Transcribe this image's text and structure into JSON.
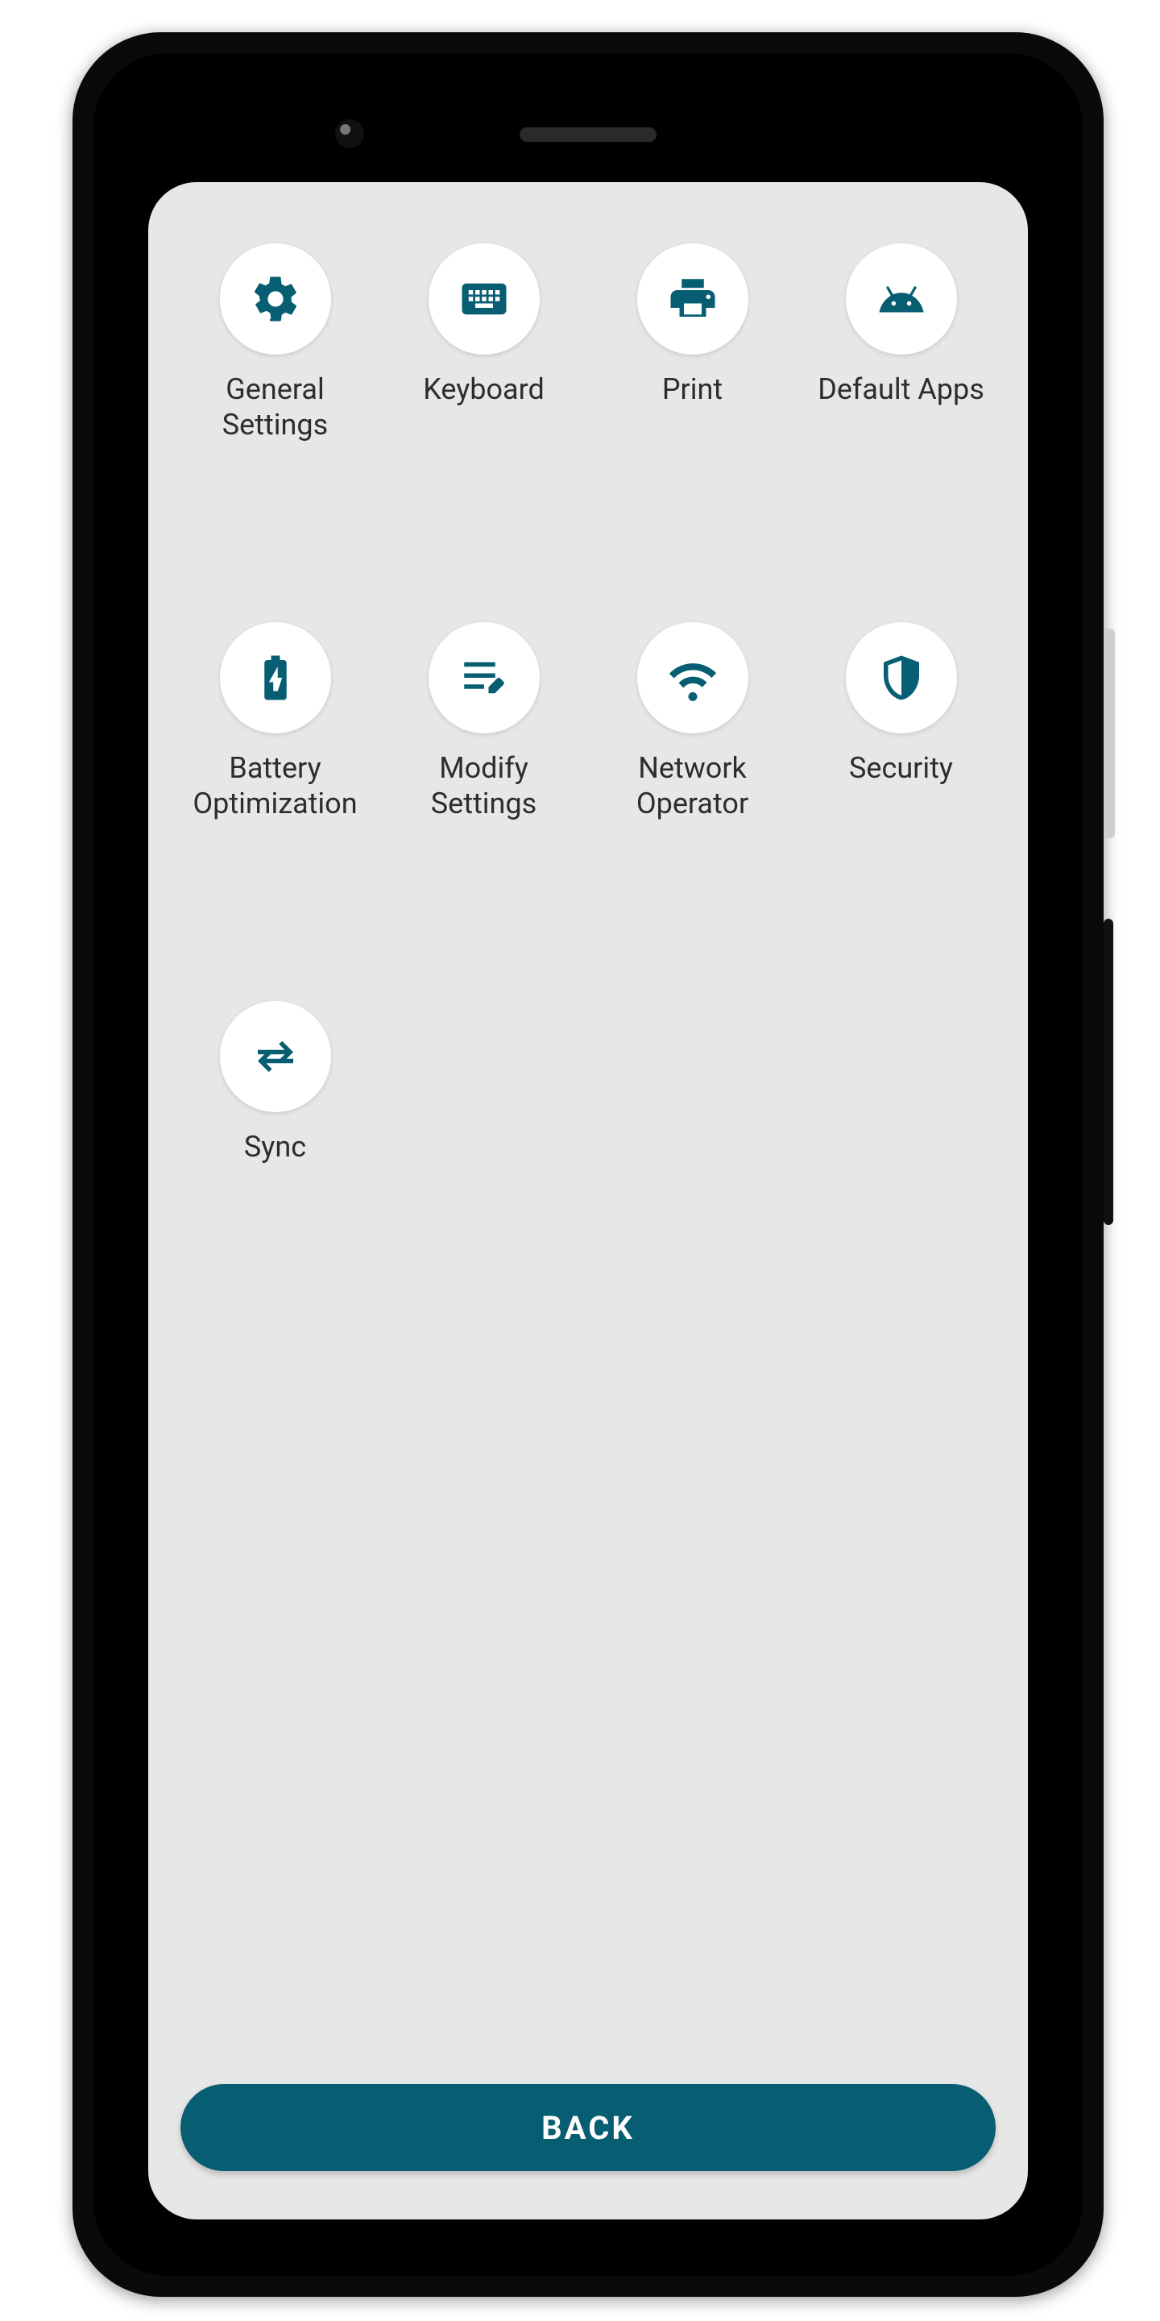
{
  "colors": {
    "accent": "#075e72",
    "screen_bg": "#e7e7e7",
    "tile_bg": "#ffffff",
    "text": "#2d2d2d"
  },
  "grid": {
    "items": [
      {
        "icon": "gear-icon",
        "label": "General Settings"
      },
      {
        "icon": "keyboard-icon",
        "label": "Keyboard"
      },
      {
        "icon": "print-icon",
        "label": "Print"
      },
      {
        "icon": "android-icon",
        "label": "Default Apps"
      },
      {
        "icon": "battery-icon",
        "label": "Battery Optimization"
      },
      {
        "icon": "edit-list-icon",
        "label": "Modify Settings"
      },
      {
        "icon": "wifi-icon",
        "label": "Network Operator"
      },
      {
        "icon": "shield-icon",
        "label": "Security"
      },
      {
        "icon": "swap-icon",
        "label": "Sync"
      }
    ]
  },
  "footer": {
    "back_label": "BACK"
  }
}
